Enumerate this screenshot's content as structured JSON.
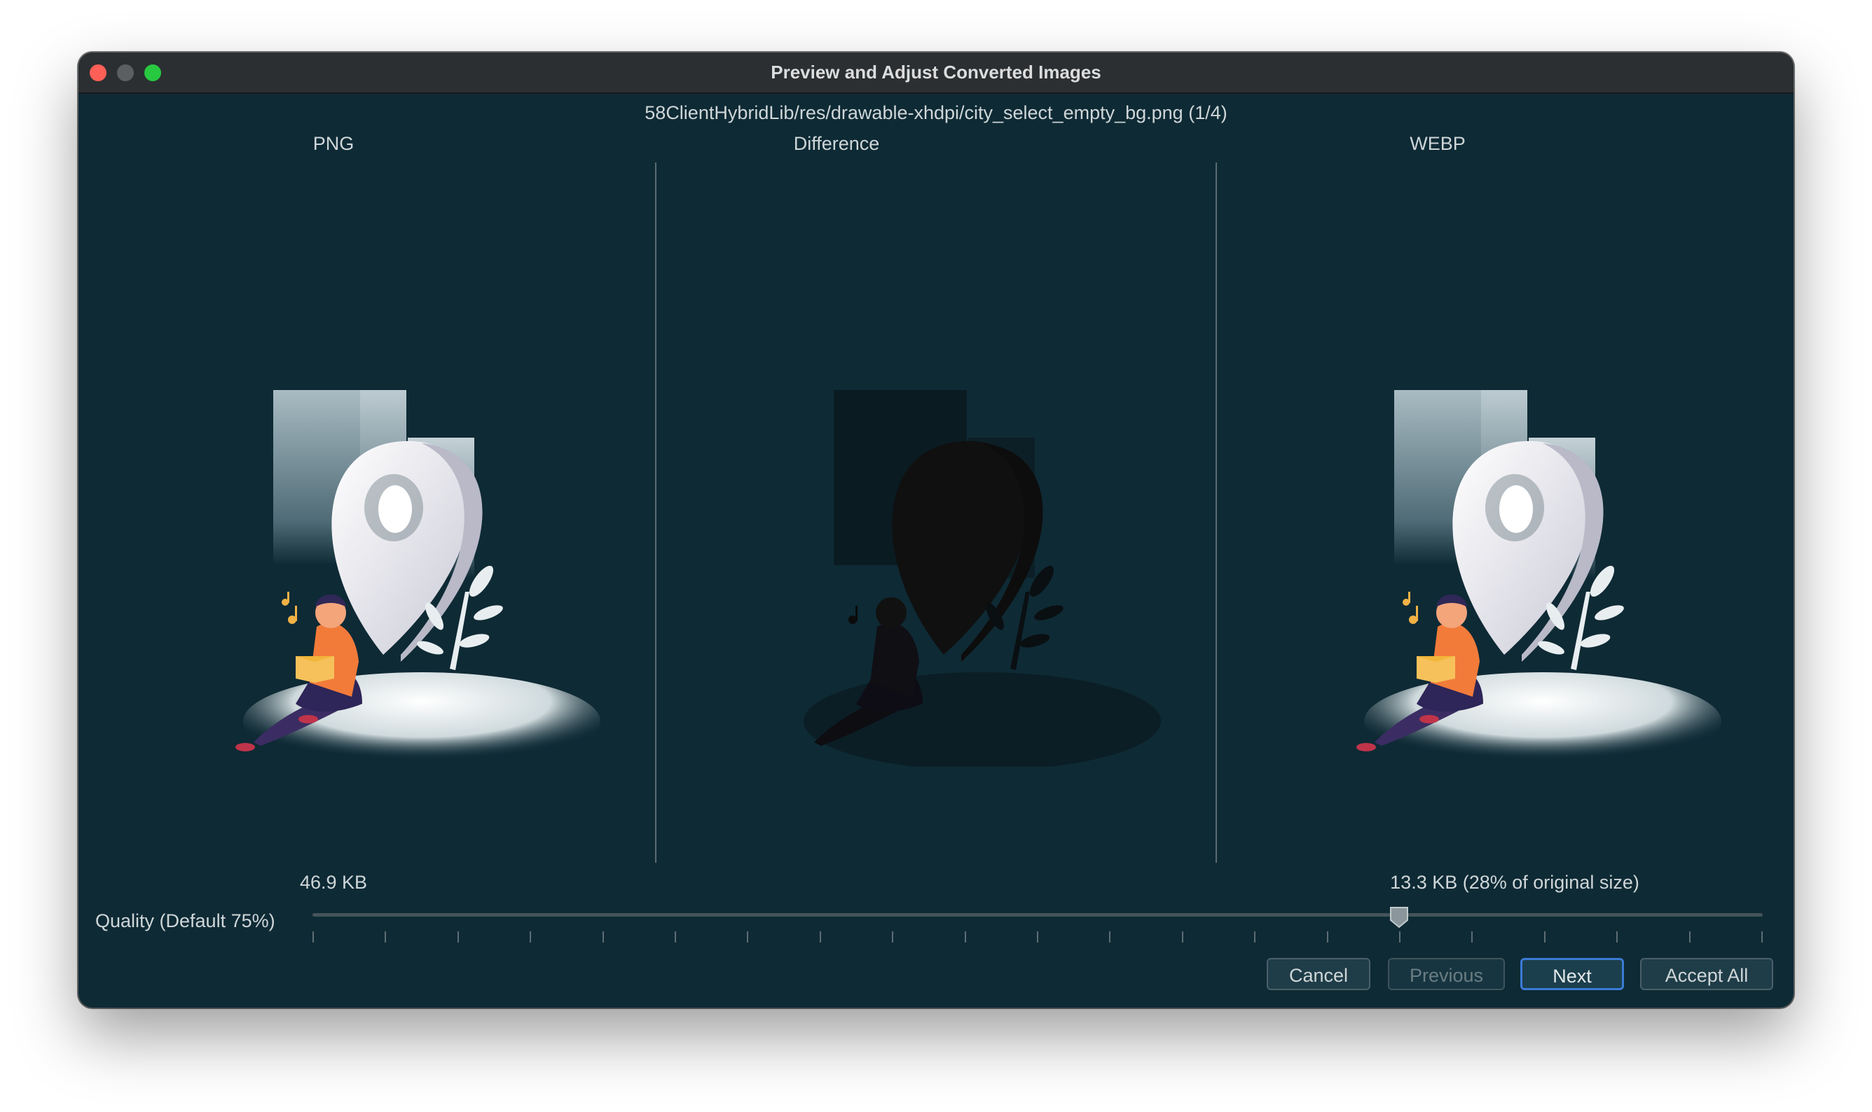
{
  "window": {
    "title": "Preview and Adjust Converted Images"
  },
  "header": {
    "file_path": "58ClientHybridLib/res/drawable-xhdpi/city_select_empty_bg.png (1/4)"
  },
  "panels": [
    {
      "label": "PNG",
      "size": "46.9 KB"
    },
    {
      "label": "Difference",
      "size": ""
    },
    {
      "label": "WEBP",
      "size": "13.3 KB (28% of original size)"
    }
  ],
  "quality": {
    "label": "Quality (Default 75%)",
    "value_percent": 75,
    "tick_count": 21
  },
  "buttons": {
    "cancel": "Cancel",
    "previous": "Previous",
    "next": "Next",
    "accept_all": "Accept All"
  },
  "colors": {
    "background": "#0e2a35",
    "accent": "#3a7bd5",
    "close": "#fe5f57",
    "maximize": "#28c840"
  },
  "icons": {
    "close": "close-traffic-light",
    "minimize": "minimize-traffic-light",
    "maximize": "maximize-traffic-light",
    "slider_thumb": "slider-thumb-icon"
  }
}
